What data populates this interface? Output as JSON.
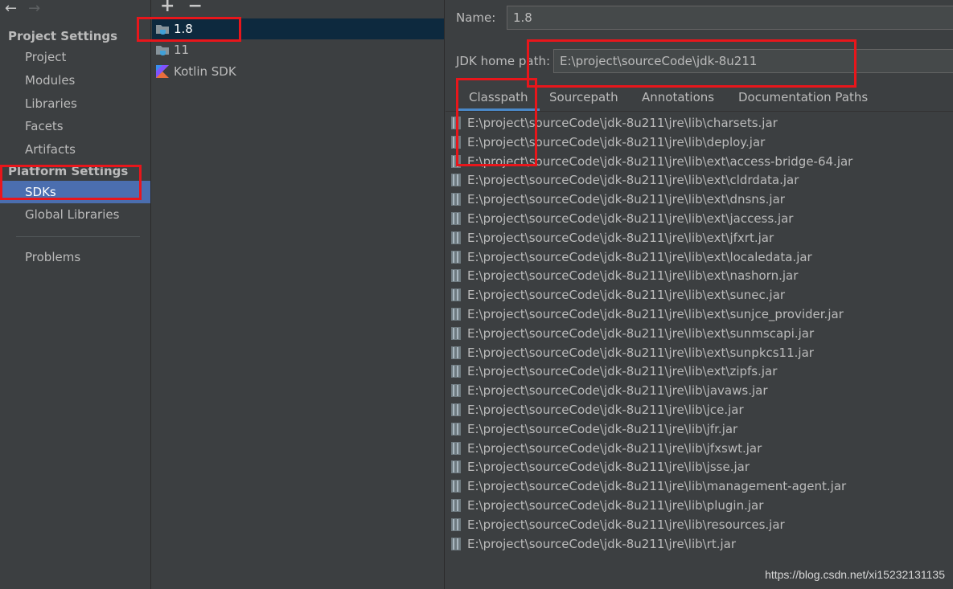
{
  "nav": {
    "back_icon": "arrow-left-icon",
    "forward_icon": "arrow-right-icon",
    "project_settings_header": "Project Settings",
    "project_items": [
      "Project",
      "Modules",
      "Libraries",
      "Facets",
      "Artifacts"
    ],
    "platform_settings_header": "Platform Settings",
    "platform_items": [
      "SDKs",
      "Global Libraries"
    ],
    "selected": "SDKs",
    "problems_label": "Problems"
  },
  "sdk_list": {
    "add_label": "+",
    "remove_label": "−",
    "items": [
      {
        "label": "1.8",
        "icon": "jdk-folder-icon"
      },
      {
        "label": "11",
        "icon": "jdk-folder-icon"
      },
      {
        "label": "Kotlin SDK",
        "icon": "kotlin-icon"
      }
    ],
    "selected": "1.8"
  },
  "detail": {
    "name_label": "Name:",
    "name_value": "1.8",
    "home_label": "JDK home path:",
    "home_value": "E:\\project\\sourceCode\\jdk-8u211",
    "tabs": [
      "Classpath",
      "Sourcepath",
      "Annotations",
      "Documentation Paths"
    ],
    "active_tab": "Classpath",
    "classpath": [
      "E:\\project\\sourceCode\\jdk-8u211\\jre\\lib\\charsets.jar",
      "E:\\project\\sourceCode\\jdk-8u211\\jre\\lib\\deploy.jar",
      "E:\\project\\sourceCode\\jdk-8u211\\jre\\lib\\ext\\access-bridge-64.jar",
      "E:\\project\\sourceCode\\jdk-8u211\\jre\\lib\\ext\\cldrdata.jar",
      "E:\\project\\sourceCode\\jdk-8u211\\jre\\lib\\ext\\dnsns.jar",
      "E:\\project\\sourceCode\\jdk-8u211\\jre\\lib\\ext\\jaccess.jar",
      "E:\\project\\sourceCode\\jdk-8u211\\jre\\lib\\ext\\jfxrt.jar",
      "E:\\project\\sourceCode\\jdk-8u211\\jre\\lib\\ext\\localedata.jar",
      "E:\\project\\sourceCode\\jdk-8u211\\jre\\lib\\ext\\nashorn.jar",
      "E:\\project\\sourceCode\\jdk-8u211\\jre\\lib\\ext\\sunec.jar",
      "E:\\project\\sourceCode\\jdk-8u211\\jre\\lib\\ext\\sunjce_provider.jar",
      "E:\\project\\sourceCode\\jdk-8u211\\jre\\lib\\ext\\sunmscapi.jar",
      "E:\\project\\sourceCode\\jdk-8u211\\jre\\lib\\ext\\sunpkcs11.jar",
      "E:\\project\\sourceCode\\jdk-8u211\\jre\\lib\\ext\\zipfs.jar",
      "E:\\project\\sourceCode\\jdk-8u211\\jre\\lib\\javaws.jar",
      "E:\\project\\sourceCode\\jdk-8u211\\jre\\lib\\jce.jar",
      "E:\\project\\sourceCode\\jdk-8u211\\jre\\lib\\jfr.jar",
      "E:\\project\\sourceCode\\jdk-8u211\\jre\\lib\\jfxswt.jar",
      "E:\\project\\sourceCode\\jdk-8u211\\jre\\lib\\jsse.jar",
      "E:\\project\\sourceCode\\jdk-8u211\\jre\\lib\\management-agent.jar",
      "E:\\project\\sourceCode\\jdk-8u211\\jre\\lib\\plugin.jar",
      "E:\\project\\sourceCode\\jdk-8u211\\jre\\lib\\resources.jar",
      "E:\\project\\sourceCode\\jdk-8u211\\jre\\lib\\rt.jar"
    ],
    "jar_icon": "jar-file-icon"
  },
  "watermark": "https://blog.csdn.net/xi15232131135",
  "colors": {
    "background": "#3c3f41",
    "selection_blue": "#4b6eaf",
    "list_selection": "#0d293e",
    "annotation_red": "#e8161b"
  }
}
